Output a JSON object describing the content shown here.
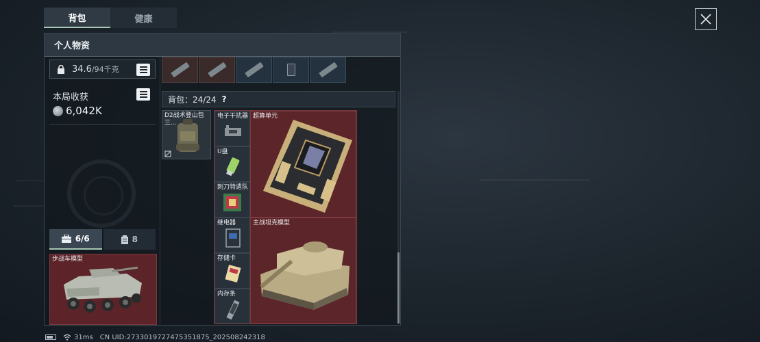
{
  "tabs": [
    {
      "label": "背包",
      "active": true
    },
    {
      "label": "健康",
      "active": false
    }
  ],
  "panel": {
    "title": "个人物资"
  },
  "weight": {
    "current": "34.6",
    "max": "/94千克"
  },
  "earnings": {
    "label": "本局收获",
    "value": "6,042K"
  },
  "subtabs": [
    {
      "icon": "toolbox-icon",
      "label": "6/6",
      "active": true
    },
    {
      "icon": "canister-icon",
      "label": "8",
      "active": false
    }
  ],
  "vehicle_slot": {
    "label": "步战车模型"
  },
  "backpack": {
    "label": "背包：24/24",
    "help": "?"
  },
  "bag_item": {
    "label": "D2战术登山包 三..."
  },
  "grid_items": [
    {
      "id": "jammer",
      "label": "电子干扰器"
    },
    {
      "id": "compute",
      "label": "超算单元"
    },
    {
      "id": "usb",
      "label": "U盘"
    },
    {
      "id": "badge",
      "label": "刺刀特遣队"
    },
    {
      "id": "relay",
      "label": "继电器"
    },
    {
      "id": "tank",
      "label": "主战坦克模型"
    },
    {
      "id": "card",
      "label": "存储卡"
    },
    {
      "id": "ram",
      "label": "内存条"
    }
  ],
  "status": {
    "ping": "31ms",
    "uid": "CN UID:2733019727475351875_202508242318"
  },
  "colors": {
    "accent": "#a9c8b5",
    "item_bg": "#5c2529",
    "panel_bg": "#12181e"
  }
}
